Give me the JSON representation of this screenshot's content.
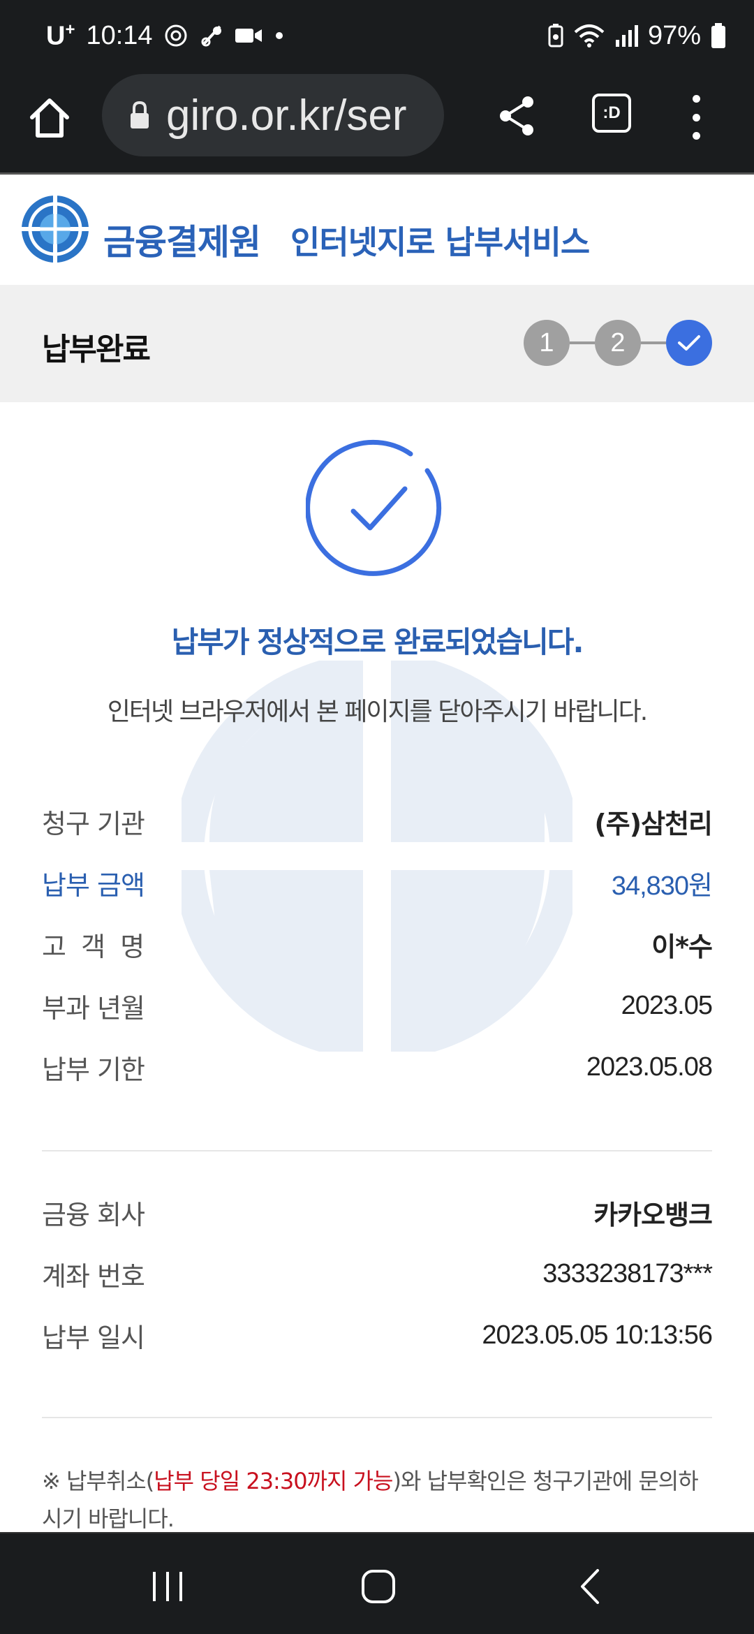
{
  "status_bar": {
    "carrier": "U",
    "carrier_sup": "+",
    "time": "10:14",
    "battery": "97%",
    "icons": [
      "camera-at-icon",
      "badge-icon",
      "video-icon",
      "dot-icon",
      "battery-saver-icon",
      "wifi-icon",
      "signal-icon",
      "battery-icon"
    ]
  },
  "browser": {
    "url": "giro.or.kr/ser",
    "tab_label": ":D"
  },
  "header": {
    "org_name": "금융결제원",
    "service_name": "인터넷지로 납부서비스"
  },
  "step_bar": {
    "title": "납부완료",
    "steps": [
      "1",
      "2"
    ]
  },
  "result": {
    "title": "납부가 정상적으로 완료되었습니다.",
    "description": "인터넷 브라우저에서 본 페이지를 닫아주시기 바랍니다."
  },
  "bill_info": [
    {
      "label": "청구 기관",
      "value": "(주)삼천리"
    },
    {
      "label": "납부 금액",
      "value": "34,830원"
    },
    {
      "label": "고  객  명",
      "value": "이*수"
    },
    {
      "label": "부과 년월",
      "value": "2023.05"
    },
    {
      "label": "납부 기한",
      "value": "2023.05.08"
    }
  ],
  "payment_info": [
    {
      "label": "금융 회사",
      "value": "카카오뱅크"
    },
    {
      "label": "계좌 번호",
      "value": "3333238173***"
    },
    {
      "label": "납부 일시",
      "value": "2023.05.05 10:13:56"
    }
  ],
  "note": {
    "prefix": "※ 납부취소(",
    "highlight": "납부 당일 23:30까지 가능",
    "suffix": ")와 납부확인은 청구기관에 문의하시기 바랍니다."
  },
  "colors": {
    "accent_blue": "#2a5fb0",
    "step_done": "#3b6fe0",
    "note_red": "#c8101e"
  }
}
